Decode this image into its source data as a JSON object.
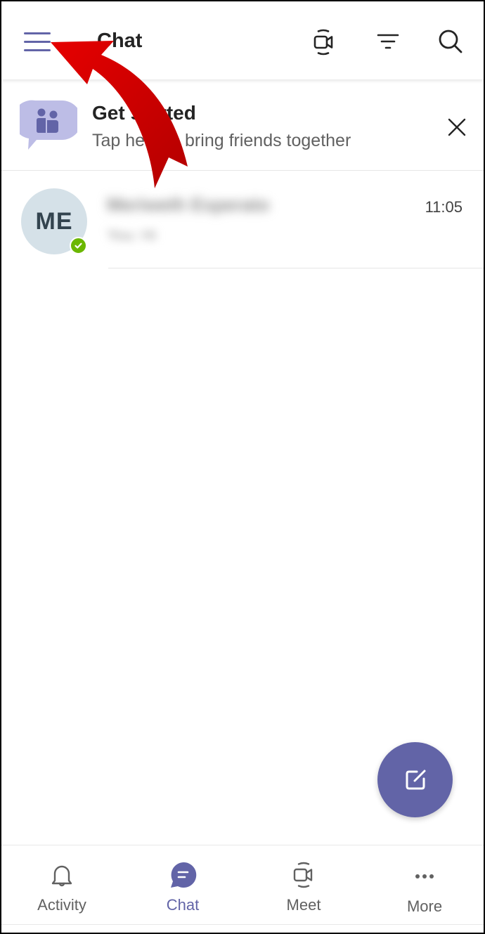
{
  "header": {
    "title": "Chat",
    "icons": {
      "menu": "hamburger-menu-icon",
      "meet_now": "video-camera-icon",
      "filter": "filter-icon",
      "search": "search-icon"
    }
  },
  "banner": {
    "title": "Get started",
    "subtitle": "Tap here to bring friends together",
    "icon": "people-chat-bubble-icon",
    "close_icon": "close-icon"
  },
  "chats": [
    {
      "initials": "ME",
      "name": "Meriweth Esperato",
      "preview": "You: Hi",
      "time": "11:05",
      "presence": "available"
    }
  ],
  "fab": {
    "icon": "compose-icon"
  },
  "bottom_nav": [
    {
      "label": "Activity",
      "icon": "bell-icon",
      "active": false
    },
    {
      "label": "Chat",
      "icon": "chat-bubble-icon",
      "active": true
    },
    {
      "label": "Meet",
      "icon": "video-camera-icon",
      "active": false
    },
    {
      "label": "More",
      "icon": "more-dots-icon",
      "active": false
    }
  ],
  "colors": {
    "brand": "#6264a7",
    "presence_available": "#6bb700",
    "annotation_arrow": "#d40000"
  },
  "annotation": {
    "type": "curved-arrow",
    "points_to": "hamburger-menu"
  }
}
